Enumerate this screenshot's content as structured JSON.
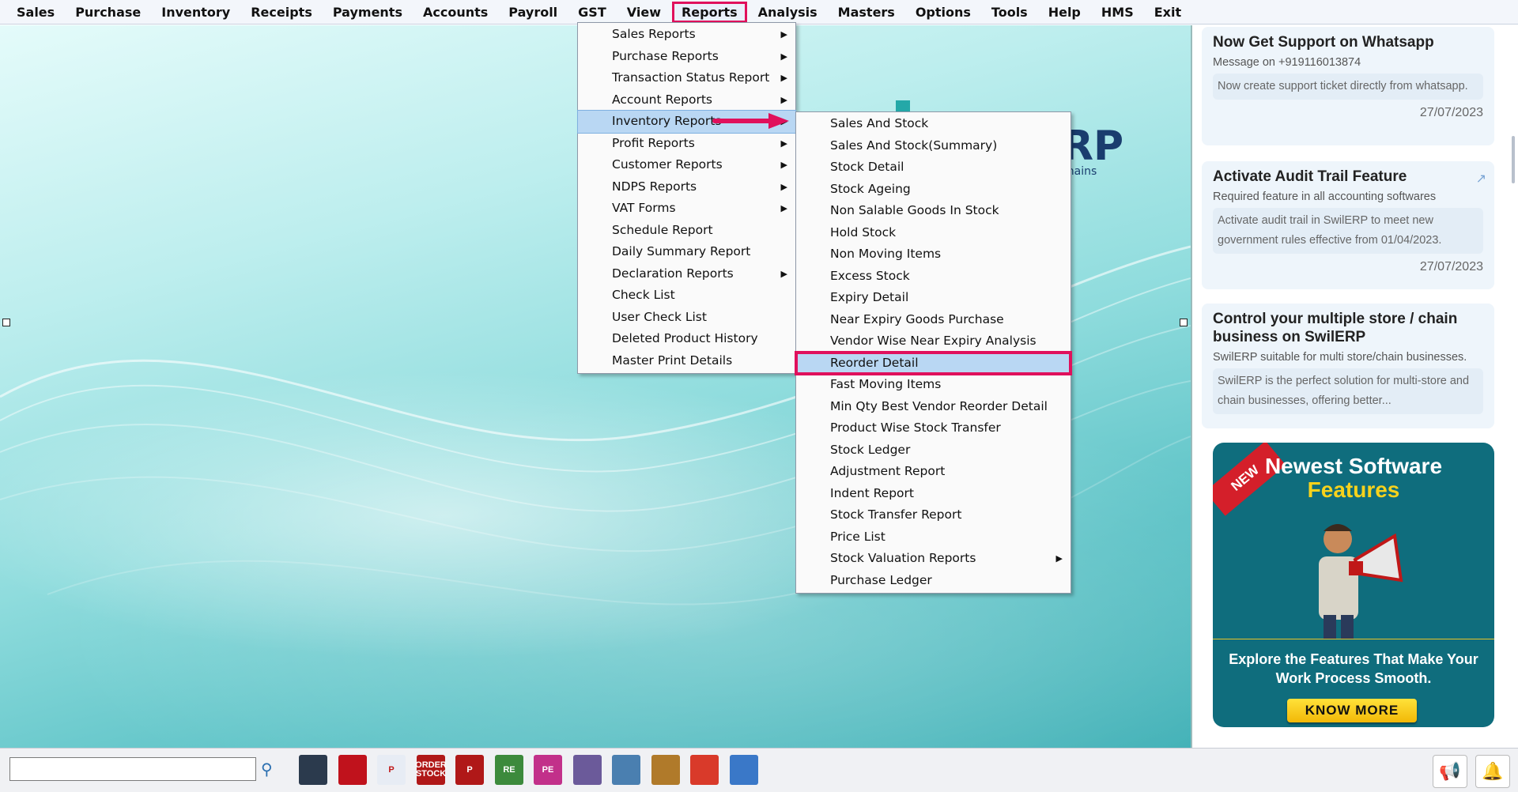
{
  "menubar": {
    "items": [
      "Sales",
      "Purchase",
      "Inventory",
      "Receipts",
      "Payments",
      "Accounts",
      "Payroll",
      "GST",
      "View",
      "Reports",
      "Analysis",
      "Masters",
      "Options",
      "Tools",
      "Help",
      "HMS",
      "Exit"
    ],
    "active": "Reports"
  },
  "logo_fragment": {
    "text": "RP",
    "tagline": "Chains"
  },
  "reports_menu": [
    {
      "label": "Sales Reports",
      "submenu": true
    },
    {
      "label": "Purchase Reports",
      "submenu": true
    },
    {
      "label": "Transaction Status Report",
      "submenu": true
    },
    {
      "label": "Account Reports",
      "submenu": true
    },
    {
      "label": "Inventory Reports",
      "submenu": true,
      "highlighted": true
    },
    {
      "label": "Profit Reports",
      "submenu": true
    },
    {
      "label": "Customer Reports",
      "submenu": true
    },
    {
      "label": "NDPS Reports",
      "submenu": true
    },
    {
      "label": "VAT Forms",
      "submenu": true
    },
    {
      "label": "Schedule Report",
      "submenu": false
    },
    {
      "label": "Daily Summary Report",
      "submenu": false
    },
    {
      "label": "Declaration Reports",
      "submenu": true
    },
    {
      "label": "Check List",
      "submenu": false
    },
    {
      "label": "User Check List",
      "submenu": false
    },
    {
      "label": "Deleted Product History",
      "submenu": false
    },
    {
      "label": "Master Print Details",
      "submenu": false
    }
  ],
  "inventory_menu": [
    {
      "label": "Sales And Stock"
    },
    {
      "label": "Sales And Stock(Summary)"
    },
    {
      "label": "Stock Detail"
    },
    {
      "label": "Stock Ageing"
    },
    {
      "label": "Non Salable Goods In Stock"
    },
    {
      "label": "Hold Stock"
    },
    {
      "label": "Non Moving Items"
    },
    {
      "label": "Excess Stock"
    },
    {
      "label": "Expiry Detail"
    },
    {
      "label": "Near Expiry Goods Purchase"
    },
    {
      "label": "Vendor Wise Near Expiry Analysis"
    },
    {
      "label": "Reorder Detail",
      "highlighted": true
    },
    {
      "label": "Fast Moving Items"
    },
    {
      "label": "Min Qty Best Vendor Reorder Detail"
    },
    {
      "label": "Product Wise Stock Transfer"
    },
    {
      "label": "Stock Ledger"
    },
    {
      "label": "Adjustment Report"
    },
    {
      "label": "Indent Report"
    },
    {
      "label": "Stock Transfer Report"
    },
    {
      "label": "Price List"
    },
    {
      "label": "Stock Valuation Reports",
      "submenu": true
    },
    {
      "label": "Purchase Ledger"
    }
  ],
  "cards": [
    {
      "title": "Now Get Support on Whatsapp",
      "subtitle": "Message on +919116013874",
      "body": "Now create support ticket directly from whatsapp.",
      "date": "27/07/2023"
    },
    {
      "title": "Activate Audit Trail Feature",
      "subtitle": "Required feature in all accounting softwares",
      "body": "Activate audit trail in SwilERP to meet new government rules effective from 01/04/2023.",
      "date": "27/07/2023"
    },
    {
      "title": "Control your multiple store / chain business on SwilERP",
      "subtitle": "SwilERP suitable for multi store/chain businesses.",
      "body": "SwilERP is the perfect solution for multi-store and chain businesses, offering better..."
    }
  ],
  "promo": {
    "ribbon": "NEW",
    "title_line1": "Newest Software",
    "title_line2": "Features",
    "description": "Explore the Features That Make Your Work Process Smooth.",
    "button": "KNOW MORE"
  },
  "toolbar": {
    "search_value": "",
    "icons": [
      {
        "name": "book-icon",
        "label": "",
        "color": "#2b3a4d"
      },
      {
        "name": "red-book-icon",
        "label": "",
        "color": "#c0121c"
      },
      {
        "name": "printer-p-icon",
        "label": "P",
        "color": "#e7ecf4"
      },
      {
        "name": "order-stock-icon",
        "label": "ORDER STOCK",
        "color": "#b01818"
      },
      {
        "name": "p-document-icon",
        "label": "P",
        "color": "#b01818"
      },
      {
        "name": "re-clipboard-icon",
        "label": "RE",
        "color": "#3c8a3c"
      },
      {
        "name": "pe-clipboard-icon",
        "label": "PE",
        "color": "#c2308a"
      },
      {
        "name": "tools-icon",
        "label": "",
        "color": "#6b5a9a"
      },
      {
        "name": "transfer-icon",
        "label": "",
        "color": "#4a7fb0"
      },
      {
        "name": "money-bag-icon",
        "label": "",
        "color": "#b07a2a"
      },
      {
        "name": "shapes-icon",
        "label": "",
        "color": "#d93a2a"
      },
      {
        "name": "scanner-icon",
        "label": "",
        "color": "#3a78c8"
      }
    ],
    "right_icons": [
      "megaphone-icon",
      "bell-icon"
    ]
  }
}
